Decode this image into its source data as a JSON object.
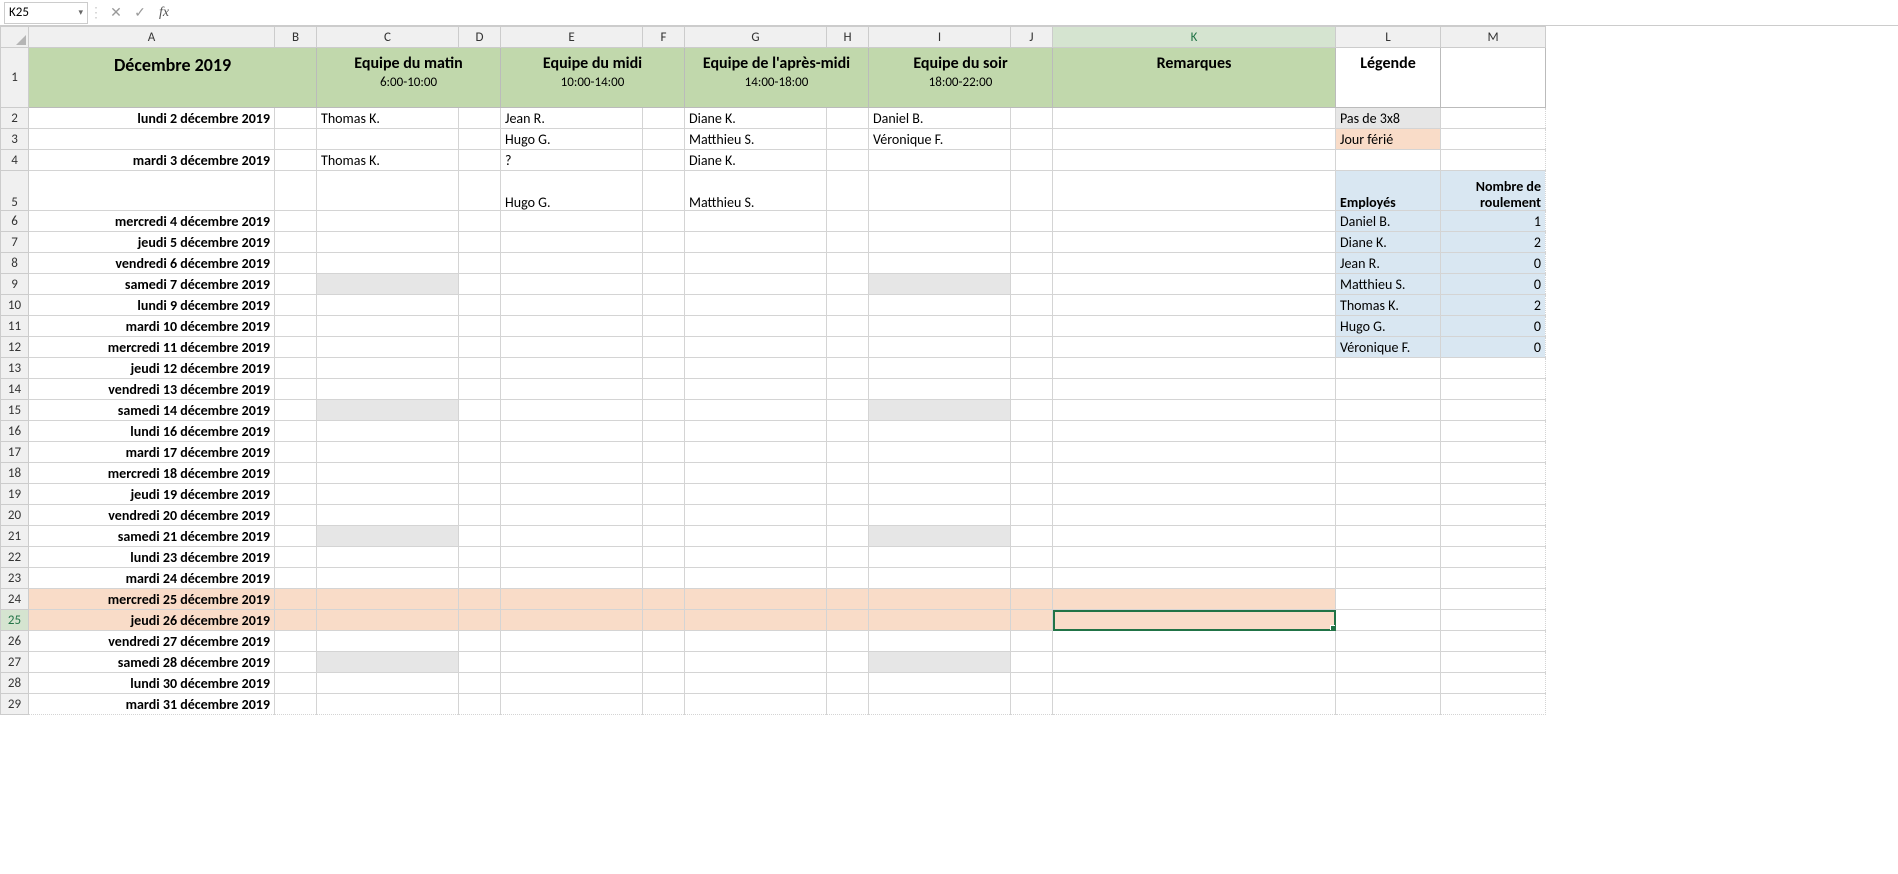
{
  "formula_bar": {
    "cell_ref": "K25",
    "formula": ""
  },
  "columns": [
    "A",
    "B",
    "C",
    "D",
    "E",
    "F",
    "G",
    "H",
    "I",
    "J",
    "K",
    "L",
    "M"
  ],
  "header_row": {
    "A": "Décembre 2019",
    "C": "Equipe du matin",
    "C_sub": "6:00-10:00",
    "E": "Equipe du midi",
    "E_sub": "10:00-14:00",
    "G": "Equipe de l'après-midi",
    "G_sub": "14:00-18:00",
    "I": "Equipe du soir",
    "I_sub": "18:00-22:00",
    "K": "Remarques",
    "L": "Légende"
  },
  "rows": [
    {
      "n": 2,
      "A": "lundi 2 décembre 2019",
      "C": "Thomas K.",
      "E": "Jean R.",
      "G": "Diane K.",
      "I": "Daniel B.",
      "L": "Pas de 3x8",
      "L_bg": "grey"
    },
    {
      "n": 3,
      "A": "",
      "C": "",
      "E": "Hugo G.",
      "G": "Matthieu S.",
      "I": "Véronique F.",
      "L": "Jour férié",
      "L_bg": "peach"
    },
    {
      "n": 4,
      "A": "mardi 3 décembre 2019",
      "C": "Thomas K.",
      "E": "?",
      "G": "Diane K.",
      "I": ""
    },
    {
      "n": 5,
      "A": "",
      "C": "",
      "E": "Hugo G.",
      "G": "Matthieu S.",
      "I": "",
      "tall": true,
      "L": "Employés",
      "M": "Nombre de roulement",
      "LM_bold": true,
      "LM_bg": "blue"
    },
    {
      "n": 6,
      "A": "mercredi 4 décembre 2019",
      "L": "Daniel B.",
      "M": "1",
      "LM_bg": "blue"
    },
    {
      "n": 7,
      "A": "jeudi 5 décembre 2019",
      "L": "Diane K.",
      "M": "2",
      "LM_bg": "blue"
    },
    {
      "n": 8,
      "A": "vendredi 6 décembre 2019",
      "L": "Jean R.",
      "M": "0",
      "LM_bg": "blue"
    },
    {
      "n": 9,
      "A": "samedi 7 décembre 2019",
      "grey_cols": [
        "C",
        "I"
      ],
      "L": "Matthieu S.",
      "M": "0",
      "LM_bg": "blue"
    },
    {
      "n": 10,
      "A": "lundi 9 décembre 2019",
      "L": "Thomas K.",
      "M": "2",
      "LM_bg": "blue"
    },
    {
      "n": 11,
      "A": "mardi 10 décembre 2019",
      "L": "Hugo G.",
      "M": "0",
      "LM_bg": "blue"
    },
    {
      "n": 12,
      "A": "mercredi 11 décembre 2019",
      "L": "Véronique F.",
      "M": "0",
      "LM_bg": "blue"
    },
    {
      "n": 13,
      "A": "jeudi 12 décembre 2019"
    },
    {
      "n": 14,
      "A": "vendredi 13 décembre 2019"
    },
    {
      "n": 15,
      "A": "samedi 14 décembre 2019",
      "grey_cols": [
        "C",
        "I"
      ]
    },
    {
      "n": 16,
      "A": "lundi 16 décembre 2019"
    },
    {
      "n": 17,
      "A": "mardi 17 décembre 2019"
    },
    {
      "n": 18,
      "A": "mercredi 18 décembre 2019"
    },
    {
      "n": 19,
      "A": "jeudi 19 décembre 2019"
    },
    {
      "n": 20,
      "A": "vendredi 20 décembre 2019"
    },
    {
      "n": 21,
      "A": "samedi 21 décembre 2019",
      "grey_cols": [
        "C",
        "I"
      ]
    },
    {
      "n": 22,
      "A": "lundi 23 décembre 2019"
    },
    {
      "n": 23,
      "A": "mardi 24 décembre 2019"
    },
    {
      "n": 24,
      "A": "mercredi 25 décembre 2019",
      "row_bg": "peach"
    },
    {
      "n": 25,
      "A": "jeudi 26 décembre 2019",
      "row_bg": "peach",
      "selected_col": "K"
    },
    {
      "n": 26,
      "A": "vendredi 27 décembre 2019"
    },
    {
      "n": 27,
      "A": "samedi 28 décembre 2019",
      "grey_cols": [
        "C",
        "I"
      ]
    },
    {
      "n": 28,
      "A": "lundi 30 décembre 2019"
    },
    {
      "n": 29,
      "A": "mardi 31 décembre 2019"
    }
  ],
  "active_cell": "K25"
}
